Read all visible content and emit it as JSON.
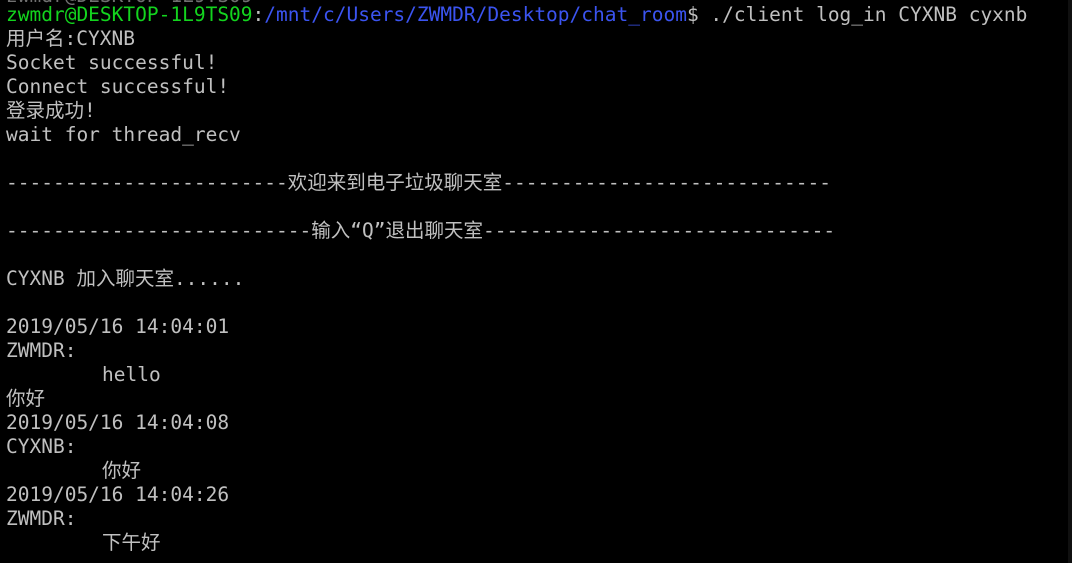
{
  "terminal": {
    "clipped_top": "zwmdr@DESKTOP-1L9TS09",
    "prompt": {
      "user_host": "zwmdr@DESKTOP-1L9TS09",
      "separator": ":",
      "path": "/mnt/c/Users/ZWMDR/Desktop/chat_room",
      "symbol": "$ ",
      "command": "./client log_in CYXNB cyxnb"
    },
    "lines": {
      "username": "用户名:CYXNB",
      "socket": "Socket successful!",
      "connect": "Connect successful!",
      "login": "登录成功!",
      "wait": "wait for thread_recv",
      "welcome": "------------------------欢迎来到电子垃圾聊天室----------------------------",
      "quit_hint": "--------------------------输入“Q”退出聊天室------------------------------",
      "join": "CYXNB 加入聊天室......",
      "msg1_time": "2019/05/16 14:04:01",
      "msg1_user": "ZWMDR:",
      "msg1_text": "hello",
      "user_input": "你好",
      "msg2_time": "2019/05/16 14:04:08",
      "msg2_user": "CYXNB:",
      "msg2_text": "你好",
      "msg3_time": "2019/05/16 14:04:26",
      "msg3_user": "ZWMDR:",
      "msg3_text": "下午好"
    }
  },
  "colors": {
    "background": "#000000",
    "text": "#c0c0c0",
    "user_host": "#13d41e",
    "path": "#3b54f0"
  }
}
